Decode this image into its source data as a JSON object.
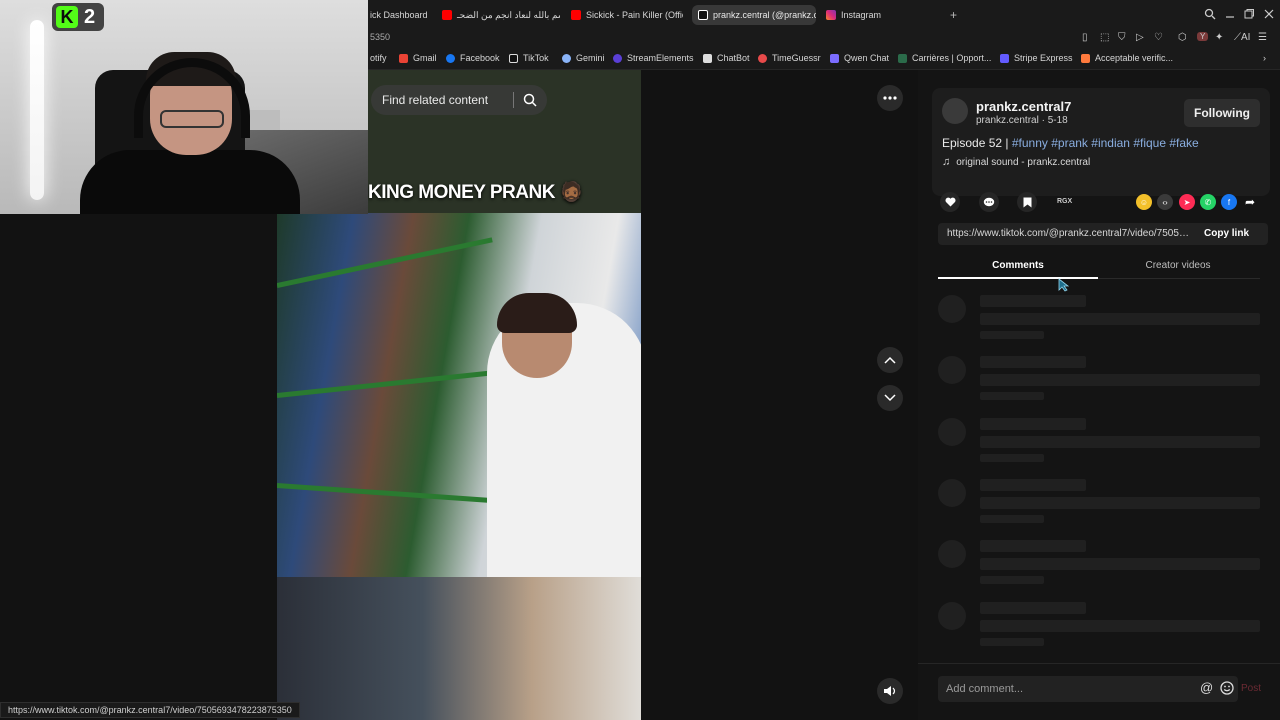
{
  "browser": {
    "tabs": [
      {
        "label": "ick Dashboard",
        "color": "#53fc18"
      },
      {
        "label": "أقسم بالله لنعاد انجم من الضحـ",
        "color": "#ff0000"
      },
      {
        "label": "Sickick - Pain Killer (Offici",
        "color": "#ff0000"
      },
      {
        "label": "prankz.central (@prankz.c",
        "color": "#ffffff"
      },
      {
        "label": "Instagram",
        "color": "#d6249f"
      }
    ],
    "new_tab": "+",
    "url_fragment": "5350",
    "bookmarks": [
      {
        "label": "otify",
        "color": "#1db954"
      },
      {
        "label": "Gmail",
        "color": "#ea4335"
      },
      {
        "label": "Facebook",
        "color": "#1877f2"
      },
      {
        "label": "TikTok",
        "color": "#ffffff"
      },
      {
        "label": "Gemini",
        "color": "#8ab4f8"
      },
      {
        "label": "StreamElements",
        "color": "#5a3fd6"
      },
      {
        "label": "ChatBot",
        "color": "#ffffff"
      },
      {
        "label": "TimeGuessr",
        "color": "#e84a4a"
      },
      {
        "label": "Qwen Chat",
        "color": "#7b6cff"
      },
      {
        "label": "Carrières | Opport...",
        "color": "#2b6b4a"
      },
      {
        "label": "Stripe Express",
        "color": "#635bff"
      },
      {
        "label": "Acceptable verific...",
        "color": "#ff7a3d"
      }
    ],
    "ext_ai": "AI"
  },
  "overlay": {
    "kick_count": "2"
  },
  "video": {
    "search_placeholder": "Find related content",
    "caption": "KING MONEY PRANK 🧔🏾"
  },
  "post": {
    "author_name": "prankz.central7",
    "author_sub": "prankz.central · 5-18",
    "follow_label": "Following",
    "desc_prefix": "Episode 52 |",
    "hashtags": [
      "#funny",
      "#prank",
      "#indian",
      "#fique",
      "#fake"
    ],
    "sound": "original sound - prankz.central",
    "rgx": "RGX",
    "link": "https://www.tiktok.com/@prankz.central7/video/75056...",
    "copy_link": "Copy link"
  },
  "tabs": {
    "comments": "Comments",
    "creator": "Creator videos"
  },
  "comment": {
    "placeholder": "Add comment...",
    "at": "@",
    "post": "Post"
  },
  "status_url": "https://www.tiktok.com/@prankz.central7/video/7505693478223875350"
}
